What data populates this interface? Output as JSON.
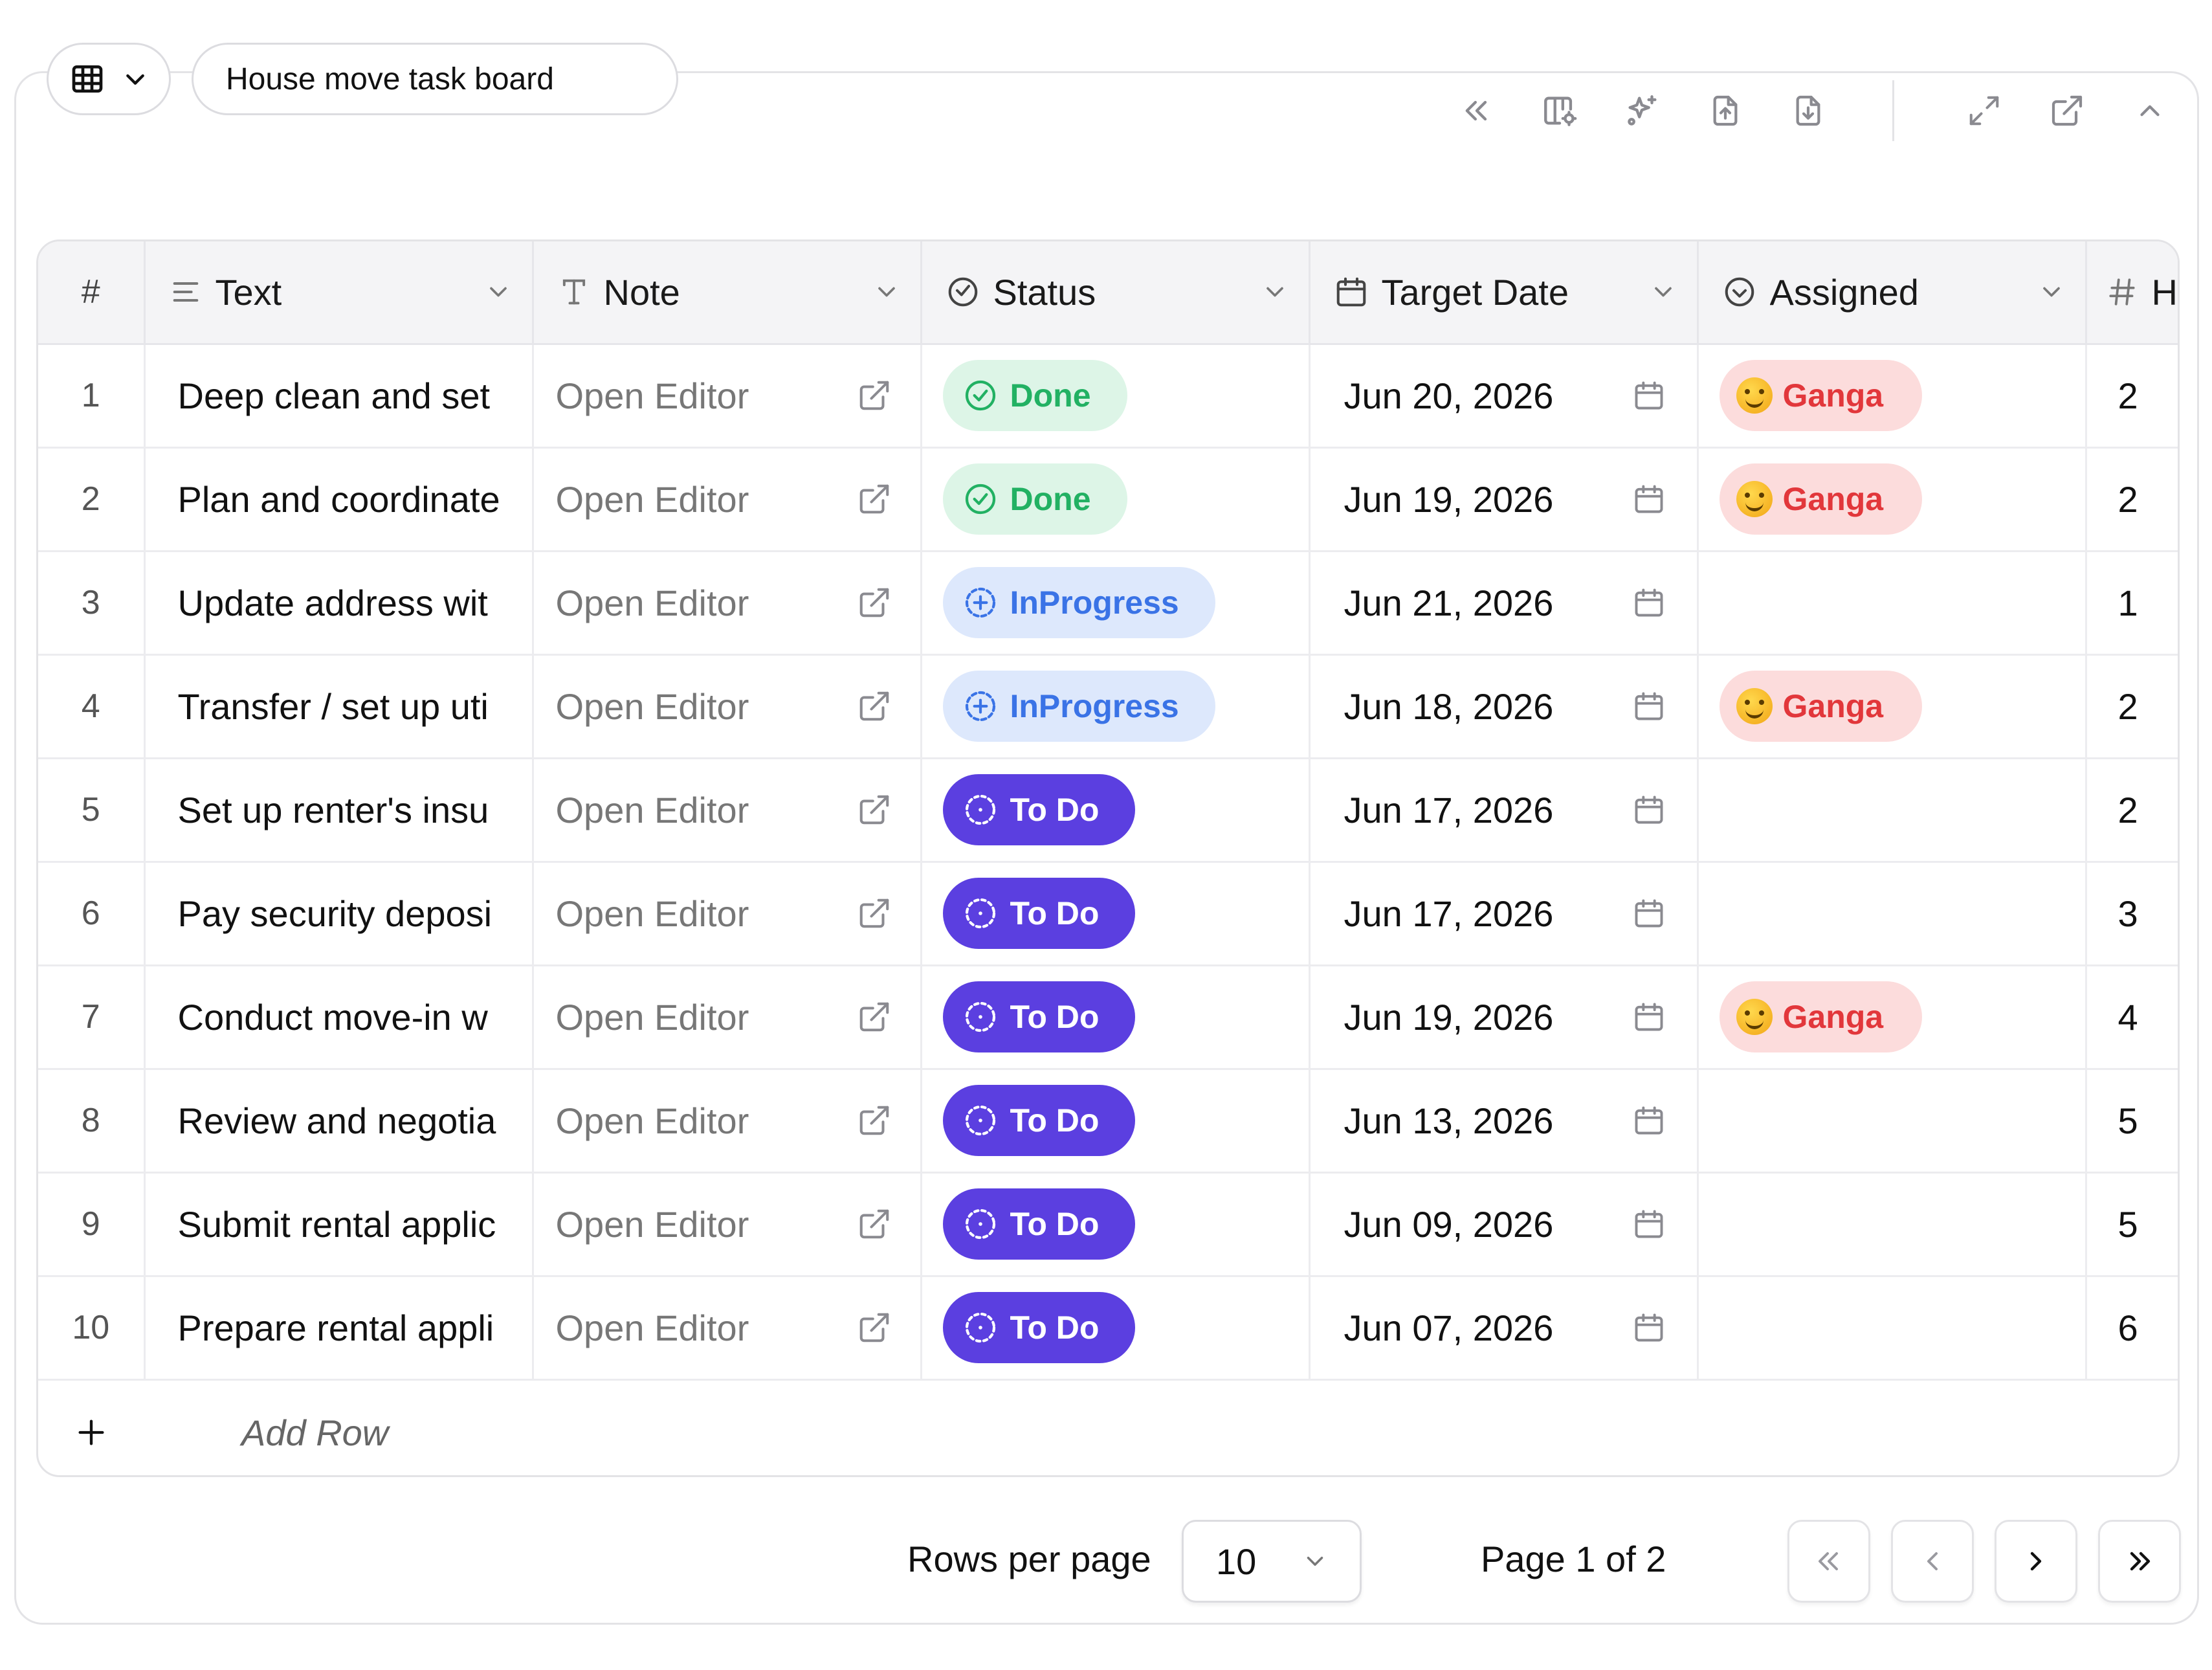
{
  "header": {
    "title": "House move task board"
  },
  "columns": {
    "num": "#",
    "text": "Text",
    "note": "Note",
    "status": "Status",
    "target_date": "Target Date",
    "assigned": "Assigned",
    "hours": "H"
  },
  "rows": [
    {
      "n": "1",
      "text": "Deep clean and set",
      "note": "Open Editor",
      "status": "Done",
      "status_kind": "done",
      "date": "Jun 20, 2026",
      "assigned": "Ganga",
      "h": "2"
    },
    {
      "n": "2",
      "text": "Plan and coordinate",
      "note": "Open Editor",
      "status": "Done",
      "status_kind": "done",
      "date": "Jun 19, 2026",
      "assigned": "Ganga",
      "h": "2"
    },
    {
      "n": "3",
      "text": "Update address wit",
      "note": "Open Editor",
      "status": "InProgress",
      "status_kind": "inprogress",
      "date": "Jun 21, 2026",
      "assigned": "",
      "h": "1"
    },
    {
      "n": "4",
      "text": "Transfer / set up uti",
      "note": "Open Editor",
      "status": "InProgress",
      "status_kind": "inprogress",
      "date": "Jun 18, 2026",
      "assigned": "Ganga",
      "h": "2"
    },
    {
      "n": "5",
      "text": "Set up renter's insu",
      "note": "Open Editor",
      "status": "To Do",
      "status_kind": "todo",
      "date": "Jun 17, 2026",
      "assigned": "",
      "h": "2"
    },
    {
      "n": "6",
      "text": "Pay security deposi",
      "note": "Open Editor",
      "status": "To Do",
      "status_kind": "todo",
      "date": "Jun 17, 2026",
      "assigned": "",
      "h": "3"
    },
    {
      "n": "7",
      "text": "Conduct move-in w",
      "note": "Open Editor",
      "status": "To Do",
      "status_kind": "todo",
      "date": "Jun 19, 2026",
      "assigned": "Ganga",
      "h": "4"
    },
    {
      "n": "8",
      "text": "Review and negotia",
      "note": "Open Editor",
      "status": "To Do",
      "status_kind": "todo",
      "date": "Jun 13, 2026",
      "assigned": "",
      "h": "5"
    },
    {
      "n": "9",
      "text": "Submit rental applic",
      "note": "Open Editor",
      "status": "To Do",
      "status_kind": "todo",
      "date": "Jun 09, 2026",
      "assigned": "",
      "h": "5"
    },
    {
      "n": "10",
      "text": "Prepare rental appli",
      "note": "Open Editor",
      "status": "To Do",
      "status_kind": "todo",
      "date": "Jun 07, 2026",
      "assigned": "",
      "h": "6"
    }
  ],
  "add_row": {
    "label": "Add Row"
  },
  "pagination": {
    "rows_per_page_label": "Rows per page",
    "rows_per_page_value": "10",
    "page_label": "Page 1 of 2"
  },
  "colors": {
    "done_bg": "#ddf5e7",
    "done_fg": "#22b163",
    "inprogress_bg": "#dde8fc",
    "inprogress_fg": "#3a73e6",
    "todo_bg": "#5b3fe0",
    "todo_fg": "#ffffff",
    "assigned_bg": "#fcdcdc",
    "assigned_fg": "#e2373b"
  },
  "icons": {
    "view_toggle": "table-grid-icon",
    "toolbar": [
      "collapse-left-icon",
      "column-settings-icon",
      "sparkle-icon",
      "upload-file-icon",
      "download-file-icon",
      "expand-icon",
      "open-external-icon",
      "chevron-up-icon"
    ]
  }
}
